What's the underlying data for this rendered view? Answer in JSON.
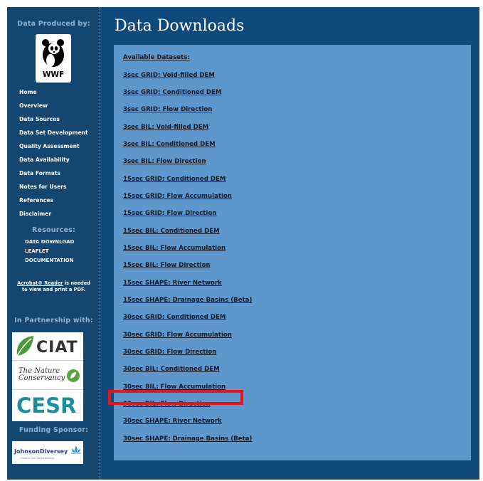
{
  "sidebar": {
    "produced_by_heading": "Data Produced by:",
    "wwf_logo_text": "WWF",
    "nav": [
      "Home",
      "Overview",
      "Data Sources",
      "Data Set Development",
      "Quality Assessment",
      "Data Availability",
      "Data Formats",
      "Notes for Users",
      "References",
      "Disclaimer"
    ],
    "resources_heading": "Resources:",
    "resources": [
      "DATA DOWNLOAD",
      "LEAFLET",
      "DOCUMENTATION"
    ],
    "acrobat_link": "Acrobat® Reader",
    "acrobat_note": " is needed to view and print a PDF.",
    "partnership_heading": "In Partnership with:",
    "partner_logos": {
      "ciat": "CIAT",
      "tnc_line1": "The Nature",
      "tnc_line2": "Conservancy",
      "cesr": "CESR"
    },
    "sponsor_heading": "Funding Sponsor:",
    "sponsor_logo": {
      "name": "JohnsonDiversey",
      "tagline": "Clean is just the beginning"
    }
  },
  "main": {
    "title": "Data Downloads",
    "datasets_heading": "Available Datasets:",
    "datasets": [
      "3sec GRID: Void-filled DEM",
      "3sec GRID: Conditioned DEM",
      "3sec GRID: Flow Direction",
      "3sec BIL: Void-filled DEM",
      "3sec BIL: Conditioned DEM",
      "3sec BIL: Flow Direction",
      "15sec GRID: Conditioned DEM",
      "15sec GRID: Flow Accumulation",
      "15sec GRID: Flow Direction",
      "15sec BIL: Conditioned DEM",
      "15sec BIL: Flow Accumulation",
      "15sec BIL: Flow Direction",
      "15sec SHAPE: River Network",
      "15sec SHAPE: Drainage Basins (Beta)",
      "30sec GRID: Conditioned DEM",
      "30sec GRID: Flow Accumulation",
      "30sec GRID: Flow Direction",
      "30sec BIL: Conditioned DEM",
      "30sec BIL: Flow Accumulation",
      "30sec BIL: Flow Direction",
      "30sec SHAPE: River Network",
      "30sec SHAPE: Drainage Basins (Beta)"
    ],
    "highlight_color": "#e8141a"
  }
}
